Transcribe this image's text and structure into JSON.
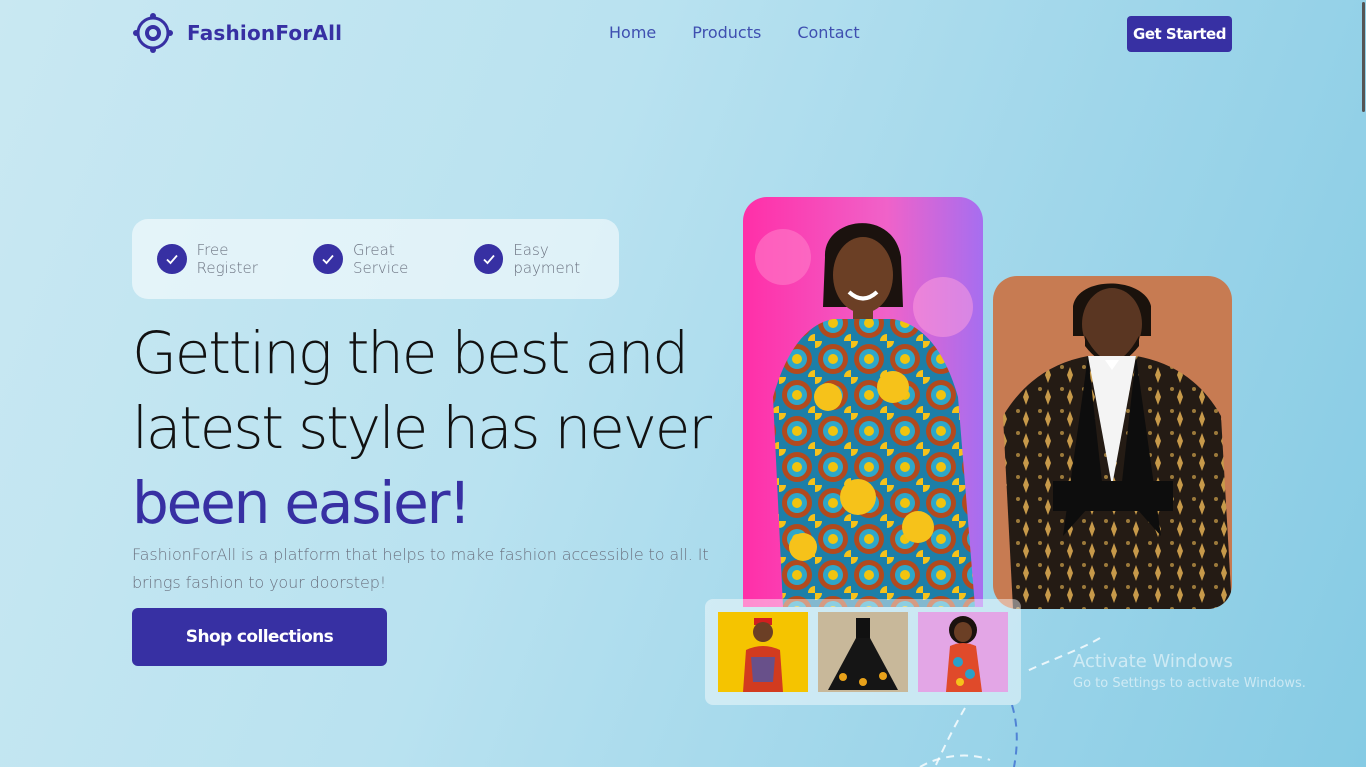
{
  "brand": {
    "name": "FashionForAll",
    "logo_icon": "orbit-logo-icon",
    "accent": "#3730a3"
  },
  "nav": {
    "items": [
      {
        "label": "Home"
      },
      {
        "label": "Products"
      },
      {
        "label": "Contact"
      }
    ],
    "cta_label": "Get Started"
  },
  "hero": {
    "badges": [
      {
        "label": "Free Register",
        "icon": "check-circle-icon"
      },
      {
        "label": "Great Service",
        "icon": "check-circle-icon"
      },
      {
        "label": "Easy payment",
        "icon": "check-circle-icon"
      }
    ],
    "headline_line1": "Getting the best and",
    "headline_line2": "latest style has never",
    "headline_accent": "been easier!",
    "description": "FashionForAll is a platform that helps to make fashion accessible to all. It brings fashion to your doorstep!",
    "button_label": "Shop collections"
  },
  "gallery": {
    "main_photos": [
      "woman-ankara-dress-photo",
      "man-embroidered-tuxedo-photo"
    ],
    "thumbnails": [
      "boy-native-attire-thumbnail",
      "black-tulle-dress-thumbnail",
      "girl-ankara-dress-thumbnail"
    ]
  },
  "os_watermark": {
    "title": "Activate Windows",
    "subtitle": "Go to Settings to activate Windows."
  }
}
